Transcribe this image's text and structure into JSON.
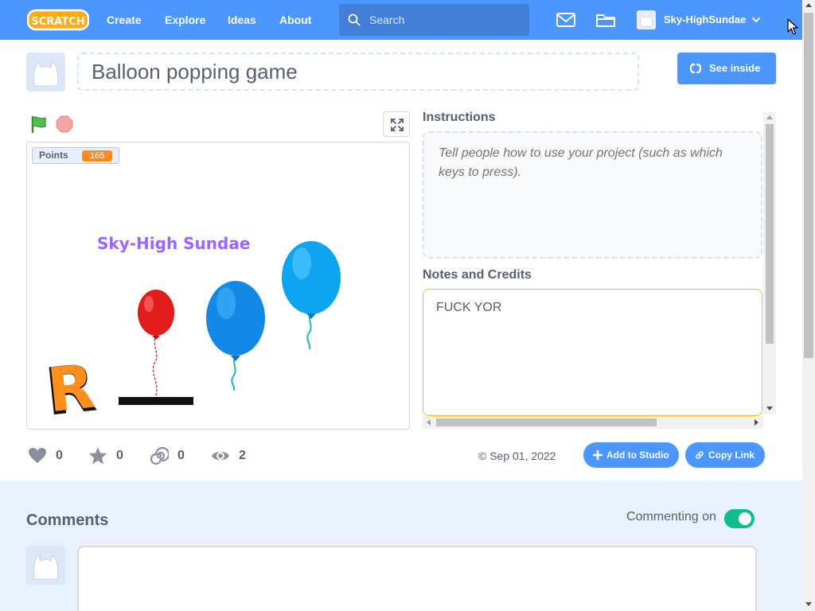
{
  "nav": {
    "logo_text": "SCRATCH",
    "links": [
      "Create",
      "Explore",
      "Ideas",
      "About"
    ],
    "search_placeholder": "Search",
    "username": "Sky-HighSundae"
  },
  "project": {
    "title": "Balloon popping game",
    "see_inside_label": "See inside"
  },
  "stage": {
    "monitor_label": "Points",
    "monitor_value": "165",
    "sprite_text": "Sky-High Sundae",
    "letter_sprite": "R"
  },
  "panel": {
    "instructions_label": "Instructions",
    "instructions_placeholder": "Tell people how to use your project (such as which keys to press).",
    "notes_label": "Notes and Credits",
    "notes_value": "FUCK YOR"
  },
  "stats": {
    "loves": "0",
    "favorites": "0",
    "remixes": "0",
    "views": "2",
    "date": "© Sep 01, 2022"
  },
  "actions": {
    "add_to_studio": "Add to Studio",
    "copy_link": "Copy Link"
  },
  "comments": {
    "title": "Comments",
    "commenting_label": "Commenting on",
    "commenting_enabled": true
  },
  "colors": {
    "brand_blue": "#4c97ff",
    "toggle_green": "#0fbd8c",
    "monitor_orange": "#ff8c1a",
    "notes_focus": "#ffbf00"
  }
}
